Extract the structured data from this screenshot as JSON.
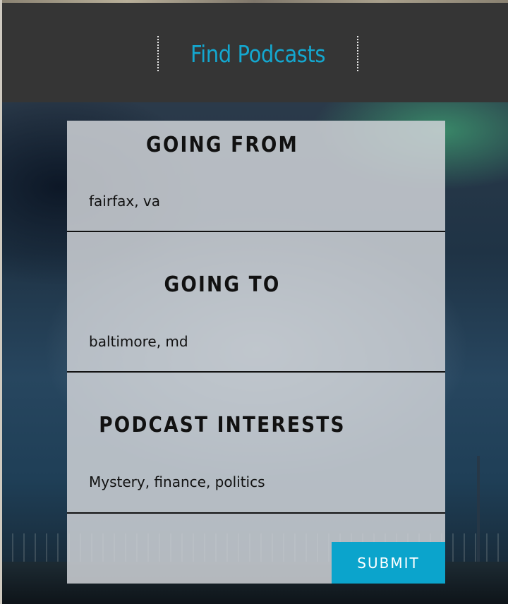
{
  "header": {
    "title": "Find Podcasts"
  },
  "form": {
    "from": {
      "label": "GOING FROM",
      "value": "fairfax, va"
    },
    "to": {
      "label": "GOING TO",
      "value": "baltimore, md"
    },
    "interests": {
      "label": "PODCAST INTERESTS",
      "value": "Mystery, finance, politics"
    },
    "submit_label": "SUBMIT"
  },
  "colors": {
    "accent": "#14a7cf",
    "button": "#0ba4cc",
    "header_bg": "#353535"
  }
}
